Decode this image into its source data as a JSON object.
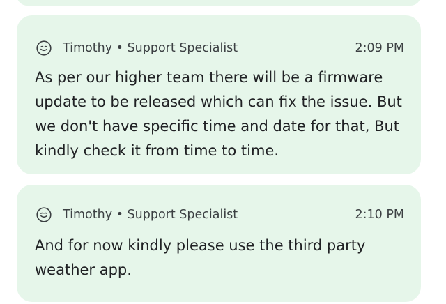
{
  "messages": [
    {
      "avatar_icon": "smiley-face-icon",
      "sender": "Timothy • Support Specialist",
      "time": "2:09 PM",
      "text": "As per our higher team there will be a firmware update to be released which can fix the issue. But we don't have specific time and date for that, But kindly check it from time to time."
    },
    {
      "avatar_icon": "smiley-face-icon",
      "sender": "Timothy • Support Specialist",
      "time": "2:10 PM",
      "text": "And for now kindly please use the third party weather app."
    }
  ],
  "colors": {
    "card_background": "#e6f6ea",
    "header_text": "#3c4043",
    "body_text": "#202124"
  }
}
